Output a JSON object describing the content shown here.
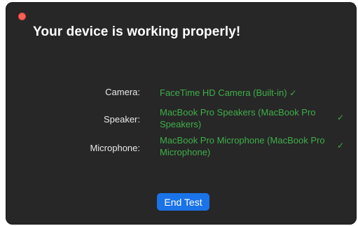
{
  "dialog": {
    "title": "Your device is working properly!"
  },
  "devices": [
    {
      "label": "Camera:",
      "value": "FaceTime HD Camera (Built-in)",
      "status": "✓"
    },
    {
      "label": "Speaker:",
      "value": "MacBook Pro Speakers (MacBook Pro Speakers)",
      "status": "✓"
    },
    {
      "label": "Microphone:",
      "value": "MacBook Pro Microphone (MacBook Pro Microphone)",
      "status": "✓"
    }
  ],
  "actions": {
    "end_test_label": "End Test"
  },
  "colors": {
    "window_bg": "#272727",
    "ok_green": "#3fae49",
    "primary_blue": "#1a73e8",
    "close_red": "#ff5f57"
  },
  "icons": {
    "close": "close-icon",
    "status": "checkmark-icon"
  }
}
